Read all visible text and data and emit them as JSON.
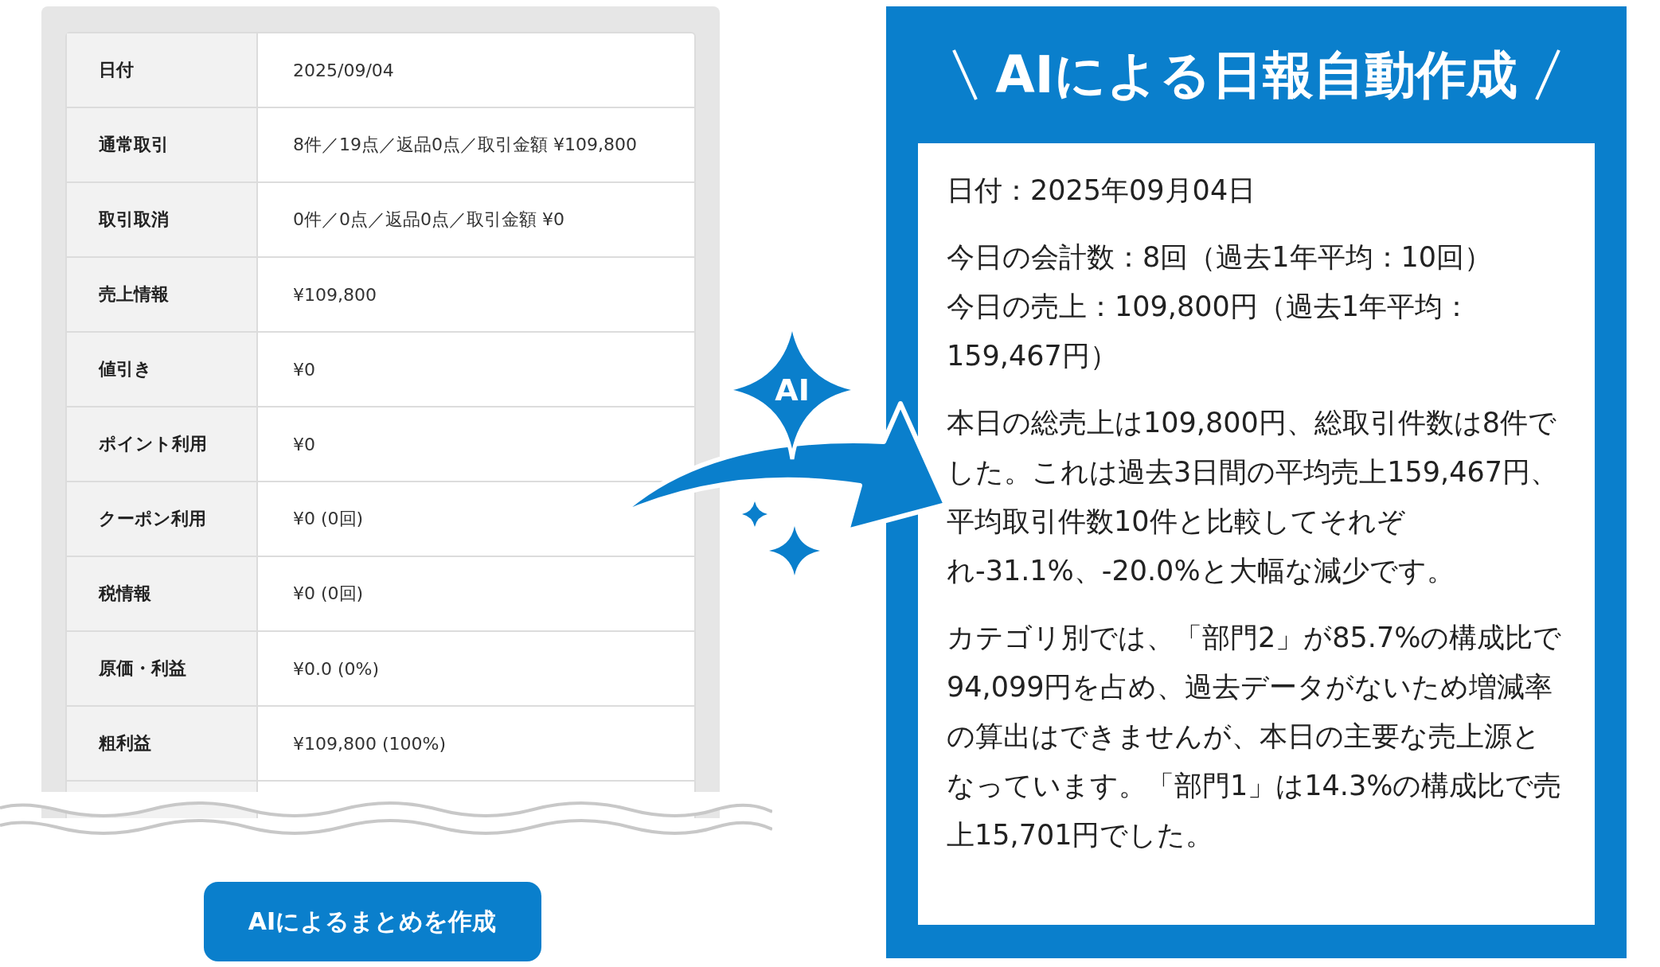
{
  "table": {
    "rows": [
      {
        "label": "日付",
        "value": "2025/09/04"
      },
      {
        "label": "通常取引",
        "value": "8件／19点／返品0点／取引金額 ¥109,800"
      },
      {
        "label": "取引取消",
        "value": "0件／0点／返品0点／取引金額 ¥0"
      },
      {
        "label": "売上情報",
        "value": "¥109,800"
      },
      {
        "label": "値引き",
        "value": "¥0"
      },
      {
        "label": "ポイント利用",
        "value": "¥0"
      },
      {
        "label": "クーポン利用",
        "value": "¥0 (0回)"
      },
      {
        "label": "税情報",
        "value": "¥0 (0回)"
      },
      {
        "label": "原価・利益",
        "value": "¥0.0 (0%)"
      },
      {
        "label": "粗利益",
        "value": "¥109,800 (100%)"
      }
    ]
  },
  "button": {
    "label": "AIによるまとめを作成"
  },
  "badge": {
    "label": "AI"
  },
  "report": {
    "title": "AIによる日報自動作成",
    "paragraphs": [
      [
        "日付：2025年09月04日"
      ],
      [
        "今日の会計数：8回（過去1年平均：10回）",
        "今日の売上：109,800円（過去1年平均：159,467円）"
      ],
      [
        "本日の総売上は109,800円、総取引件数は8件でした。これは過去3日間の平均売上159,467円、平均取引件数10件と比較してそれぞれ-31.1%、-20.0%と大幅な減少です。"
      ],
      [
        "カテゴリ別では、「部門2」が85.7%の構成比で94,099円を占め、過去データがないため増減率の算出はできませんが、本日の主要な売上源となっています。「部門1」は14.3%の構成比で売上15,701円でした。"
      ]
    ]
  }
}
